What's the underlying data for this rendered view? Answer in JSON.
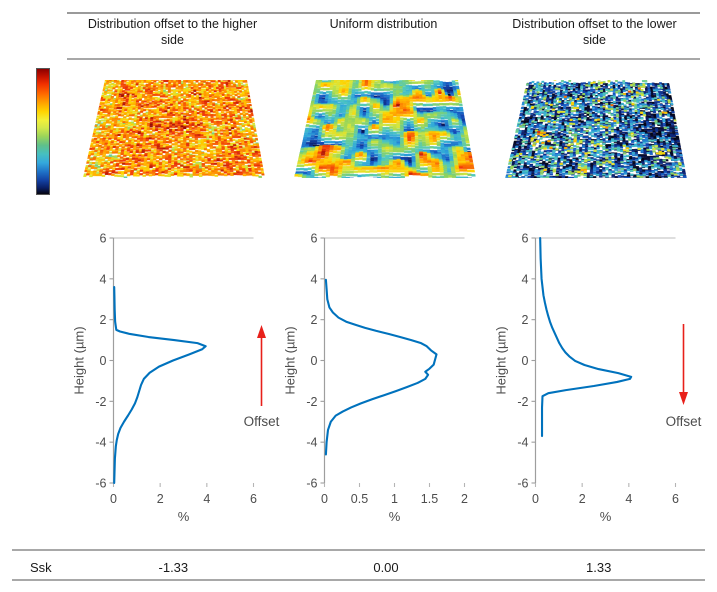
{
  "header": {
    "columns": [
      "Distribution offset to the higher side",
      "Uniform distribution",
      "Distribution offset to the lower side"
    ]
  },
  "colorbar": {
    "name": "height-colormap",
    "top_color": "#8b0000",
    "bottom_color": "#05050f",
    "description": "jet-like height colour scale, high = red, low = dark blue"
  },
  "surfaces": [
    {
      "name": "surface-higher-side",
      "dominant_tone": "yellow-orange",
      "description": "Rough surface, peaks dominant, mostly yellow and orange with scattered blue pits"
    },
    {
      "name": "surface-uniform",
      "dominant_tone": "green-cyan",
      "description": "Smooth undulating surface, balanced green and cyan with red and blue patches"
    },
    {
      "name": "surface-lower-side",
      "dominant_tone": "blue-cyan",
      "description": "Rough surface, valleys dominant, mostly blue and cyan with red spikes"
    }
  ],
  "footer": {
    "parameter_label": "Ssk",
    "values": [
      "-1.33",
      "0.00",
      "1.33"
    ]
  },
  "annotations": {
    "offset_label": "Offset",
    "arrow_color": "#e8201a",
    "line_color": "#0072BD"
  },
  "chart_data": [
    {
      "type": "line",
      "name": "height-distribution-higher-side",
      "title": "",
      "xlabel": "%",
      "ylabel": "Height (µm)",
      "xlim": [
        0,
        6
      ],
      "ylim": [
        -6,
        6
      ],
      "xticks": [
        0,
        2,
        4,
        6
      ],
      "yticks": [
        -6,
        -4,
        -2,
        0,
        2,
        4,
        6
      ],
      "grid": false,
      "legend": null,
      "annotation": {
        "text": "Offset",
        "arrow": "up"
      },
      "series": [
        {
          "name": "distribution",
          "x": [
            0.03,
            0.04,
            0.05,
            0.06,
            0.08,
            0.1,
            0.14,
            0.2,
            0.3,
            0.45,
            0.62,
            0.78,
            0.92,
            1.02,
            1.1,
            1.18,
            1.3,
            1.55,
            1.95,
            2.55,
            3.25,
            3.8,
            3.95,
            3.6,
            2.6,
            1.5,
            0.7,
            0.28,
            0.12,
            0.07,
            0.05,
            0.04,
            0.03
          ],
          "y": [
            -6.0,
            -5.6,
            -5.2,
            -4.8,
            -4.5,
            -4.2,
            -3.9,
            -3.6,
            -3.3,
            -3.0,
            -2.7,
            -2.4,
            -2.1,
            -1.8,
            -1.5,
            -1.2,
            -0.9,
            -0.6,
            -0.3,
            0.0,
            0.3,
            0.55,
            0.7,
            0.85,
            1.0,
            1.15,
            1.3,
            1.42,
            1.5,
            1.9,
            2.5,
            3.1,
            3.6
          ]
        }
      ]
    },
    {
      "type": "line",
      "name": "height-distribution-uniform",
      "title": "",
      "xlabel": "%",
      "ylabel": "Height (µm)",
      "xlim": [
        0,
        2
      ],
      "ylim": [
        -6,
        6
      ],
      "xticks": [
        0,
        0.5,
        1,
        1.5,
        2
      ],
      "yticks": [
        -6,
        -4,
        -2,
        0,
        2,
        4,
        6
      ],
      "grid": false,
      "legend": null,
      "annotation": null,
      "series": [
        {
          "name": "distribution",
          "x": [
            0.02,
            0.03,
            0.05,
            0.09,
            0.16,
            0.26,
            0.38,
            0.52,
            0.68,
            0.85,
            1.02,
            1.18,
            1.33,
            1.44,
            1.48,
            1.44,
            1.5,
            1.56,
            1.6,
            1.52,
            1.46,
            1.38,
            1.24,
            1.08,
            0.92,
            0.74,
            0.58,
            0.44,
            0.31,
            0.2,
            0.12,
            0.07,
            0.04,
            0.03,
            0.02
          ],
          "y": [
            -4.6,
            -4.0,
            -3.4,
            -3.0,
            -2.7,
            -2.5,
            -2.3,
            -2.1,
            -1.9,
            -1.7,
            -1.5,
            -1.3,
            -1.1,
            -0.9,
            -0.7,
            -0.55,
            -0.4,
            -0.2,
            0.3,
            0.5,
            0.7,
            0.85,
            1.0,
            1.15,
            1.3,
            1.45,
            1.6,
            1.75,
            1.9,
            2.1,
            2.35,
            2.6,
            3.0,
            3.5,
            3.95
          ]
        }
      ]
    },
    {
      "type": "line",
      "name": "height-distribution-lower-side",
      "title": "",
      "xlabel": "%",
      "ylabel": "Height (µm)",
      "xlim": [
        0,
        6
      ],
      "ylim": [
        -6,
        6
      ],
      "xticks": [
        0,
        2,
        4,
        6
      ],
      "yticks": [
        -6,
        -4,
        -2,
        0,
        2,
        4,
        6
      ],
      "grid": false,
      "legend": null,
      "annotation": {
        "text": "Offset",
        "arrow": "down"
      },
      "series": [
        {
          "name": "distribution",
          "x": [
            0.28,
            0.28,
            0.3,
            0.55,
            1.3,
            2.5,
            3.5,
            4.05,
            4.1,
            3.55,
            2.7,
            2.1,
            1.7,
            1.45,
            1.28,
            1.15,
            1.02,
            0.92,
            0.82,
            0.72,
            0.62,
            0.54,
            0.47,
            0.4,
            0.34,
            0.3,
            0.26,
            0.24,
            0.22,
            0.21,
            0.2
          ],
          "y": [
            -3.7,
            -2.3,
            -1.75,
            -1.6,
            -1.45,
            -1.25,
            -1.05,
            -0.9,
            -0.8,
            -0.62,
            -0.42,
            -0.22,
            -0.02,
            0.2,
            0.4,
            0.6,
            0.85,
            1.1,
            1.35,
            1.6,
            1.9,
            2.2,
            2.5,
            2.85,
            3.2,
            3.6,
            4.0,
            4.5,
            5.0,
            5.5,
            6.0
          ]
        }
      ]
    }
  ]
}
